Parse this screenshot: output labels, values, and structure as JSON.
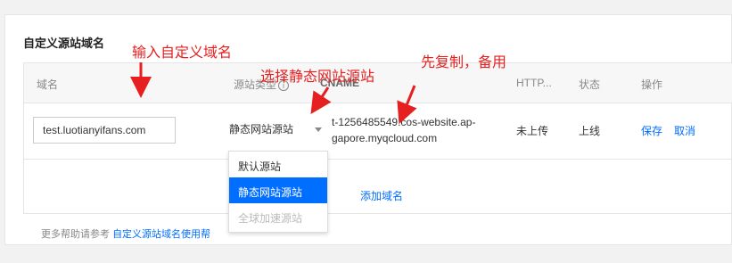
{
  "section_title": "自定义源站域名",
  "table": {
    "headers": {
      "domain": "域名",
      "source_type": "源站类型",
      "cname": "CNAME",
      "http": "HTTP...",
      "status": "状态",
      "actions": "操作"
    },
    "row": {
      "domain_value": "test.luotianyifans.com",
      "source_type_value": "静态网站源站",
      "cname_line1": "t-1256485549.cos-website.ap-",
      "cname_line2": "gapore.myqcloud.com",
      "http_value": "未上传",
      "status_value": "上线",
      "save_label": "保存",
      "cancel_label": "取消"
    },
    "add_domain_label": "添加域名"
  },
  "dropdown": {
    "options": [
      "默认源站",
      "静态网站源站",
      "全球加速源站"
    ],
    "selected": "静态网站源站"
  },
  "footer": {
    "prefix": "更多帮助请参考",
    "link": "自定义源站域名使用帮"
  },
  "annotations": {
    "input_domain": "输入自定义域名",
    "choose_source": "选择静态网站源站",
    "copy_backup": "先复制，备用"
  },
  "colors": {
    "link": "#006eff",
    "annotation": "#e62020",
    "selected_bg": "#006eff"
  },
  "icons": {
    "source_type_help": "info-circle-icon",
    "select_caret": "caret-down-icon"
  }
}
